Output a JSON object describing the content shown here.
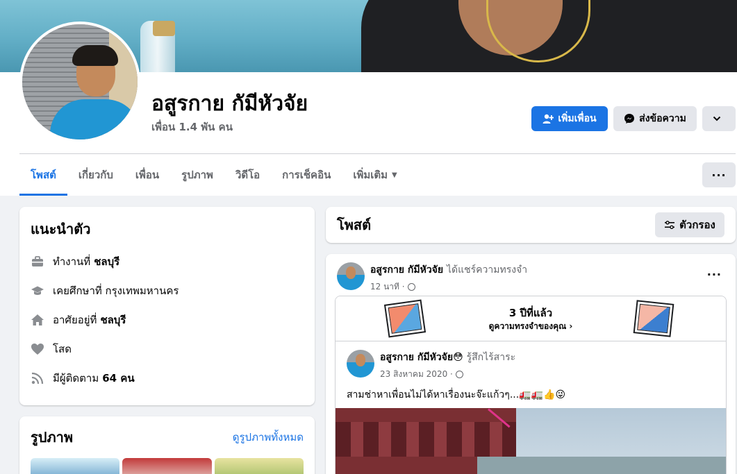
{
  "profile": {
    "name": "อสูรกาย กัมีหัวจัย",
    "friends_count": "เพื่อน 1.4 พัน คน"
  },
  "actions": {
    "add_friend": "เพิ่มเพื่อน",
    "message": "ส่งข้อความ"
  },
  "tabs": [
    {
      "label": "โพสต์",
      "active": true
    },
    {
      "label": "เกี่ยวกับ"
    },
    {
      "label": "เพื่อน"
    },
    {
      "label": "รูปภาพ"
    },
    {
      "label": "วิดีโอ"
    },
    {
      "label": "การเช็คอิน"
    },
    {
      "label": "เพิ่มเติม"
    }
  ],
  "intro": {
    "title": "แนะนำตัว",
    "items": [
      {
        "icon": "briefcase-icon",
        "text": "ทำงานที่",
        "bold": "ชลบุรี"
      },
      {
        "icon": "graduation-cap-icon",
        "text": "เคยศึกษาที่ กรุงเทพมหานคร",
        "bold": ""
      },
      {
        "icon": "home-icon",
        "text": "อาศัยอยู่ที่",
        "bold": "ชลบุรี"
      },
      {
        "icon": "heart-icon",
        "text": "โสด",
        "bold": ""
      },
      {
        "icon": "rss-icon",
        "text": "มีผู้ติดตาม",
        "bold": "64 คน"
      }
    ]
  },
  "photos": {
    "title": "รูปภาพ",
    "see_all": "ดูรูปภาพทั้งหมด"
  },
  "posts": {
    "title": "โพสต์",
    "filter": "ตัวกรอง"
  },
  "post": {
    "author": "อสูรกาย กัมีหัวจัย",
    "action": "ได้แชร์ความทรงจำ",
    "time": "12 นาที ·",
    "memory": {
      "title": "3 ปีที่แล้ว",
      "subtitle": "ดูความทรงจำของคุณ ›"
    },
    "inner": {
      "author": "อสูรกาย กัมีหัวจัย😳",
      "feeling": "รู้สึกไร้สาระ",
      "date": "23 สิงหาคม 2020 ·",
      "text": "สามช่าหาเพื่อนไม่ได้หาเรื่องนะจ๊ะแก้วๆ...🚛🚛👍😜"
    }
  },
  "colors": {
    "accent": "#1b74e4",
    "background": "#f0f2f5",
    "secondary_button": "#e4e6eb",
    "muted_text": "#65676b"
  }
}
